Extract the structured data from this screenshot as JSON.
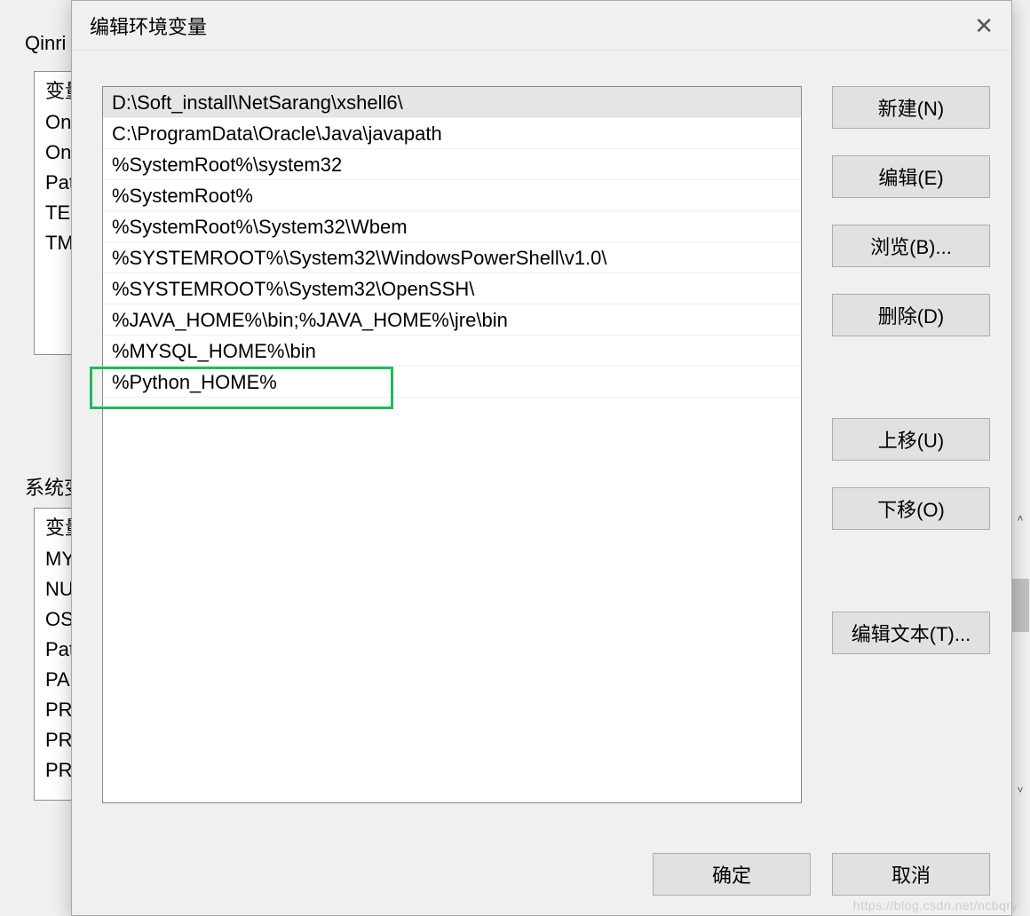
{
  "background": {
    "user_section_label": "Qinri",
    "system_section_label": "系统变",
    "user_vars": [
      "变量",
      "On",
      "On",
      "Pat",
      "TEI",
      "TM"
    ],
    "system_vars": [
      "变量",
      "MY",
      "NU",
      "OS",
      "Pat",
      "PA",
      "PR",
      "PR",
      "PR"
    ]
  },
  "dialog": {
    "title": "编辑环境变量",
    "paths": [
      "D:\\Soft_install\\NetSarang\\xshell6\\",
      "C:\\ProgramData\\Oracle\\Java\\javapath",
      "%SystemRoot%\\system32",
      "%SystemRoot%",
      "%SystemRoot%\\System32\\Wbem",
      "%SYSTEMROOT%\\System32\\WindowsPowerShell\\v1.0\\",
      "%SYSTEMROOT%\\System32\\OpenSSH\\",
      "%JAVA_HOME%\\bin;%JAVA_HOME%\\jre\\bin",
      "%MYSQL_HOME%\\bin",
      "%Python_HOME%"
    ],
    "selected_index": 0,
    "highlighted_index": 9,
    "buttons": {
      "new": "新建(N)",
      "edit": "编辑(E)",
      "browse": "浏览(B)...",
      "delete": "删除(D)",
      "move_up": "上移(U)",
      "move_down": "下移(O)",
      "edit_text": "编辑文本(T)...",
      "ok": "确定",
      "cancel": "取消"
    }
  },
  "watermark": "https://blog.csdn.net/ncbqry"
}
